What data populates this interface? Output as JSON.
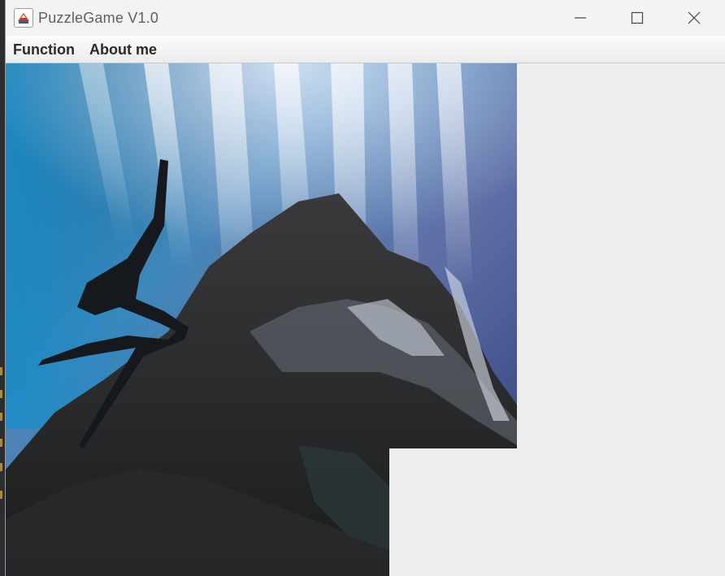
{
  "window": {
    "title": "PuzzleGame V1.0",
    "icons": {
      "app": "java-cup-icon",
      "minimize": "minimize-icon",
      "maximize": "maximize-icon",
      "close": "close-icon"
    }
  },
  "menubar": {
    "items": [
      {
        "label": "Function"
      },
      {
        "label": "About me"
      }
    ]
  },
  "board": {
    "image_description": "underwater cave with light rays",
    "grid_columns": 4,
    "grid_rows": 4,
    "empty_tile": {
      "row": 4,
      "col": 4
    }
  },
  "colors": {
    "window_bg": "#eeeeee",
    "titlebar_bg": "#f3f3f3",
    "title_text": "#5f5f5f",
    "menu_text": "#2a2a2a"
  }
}
